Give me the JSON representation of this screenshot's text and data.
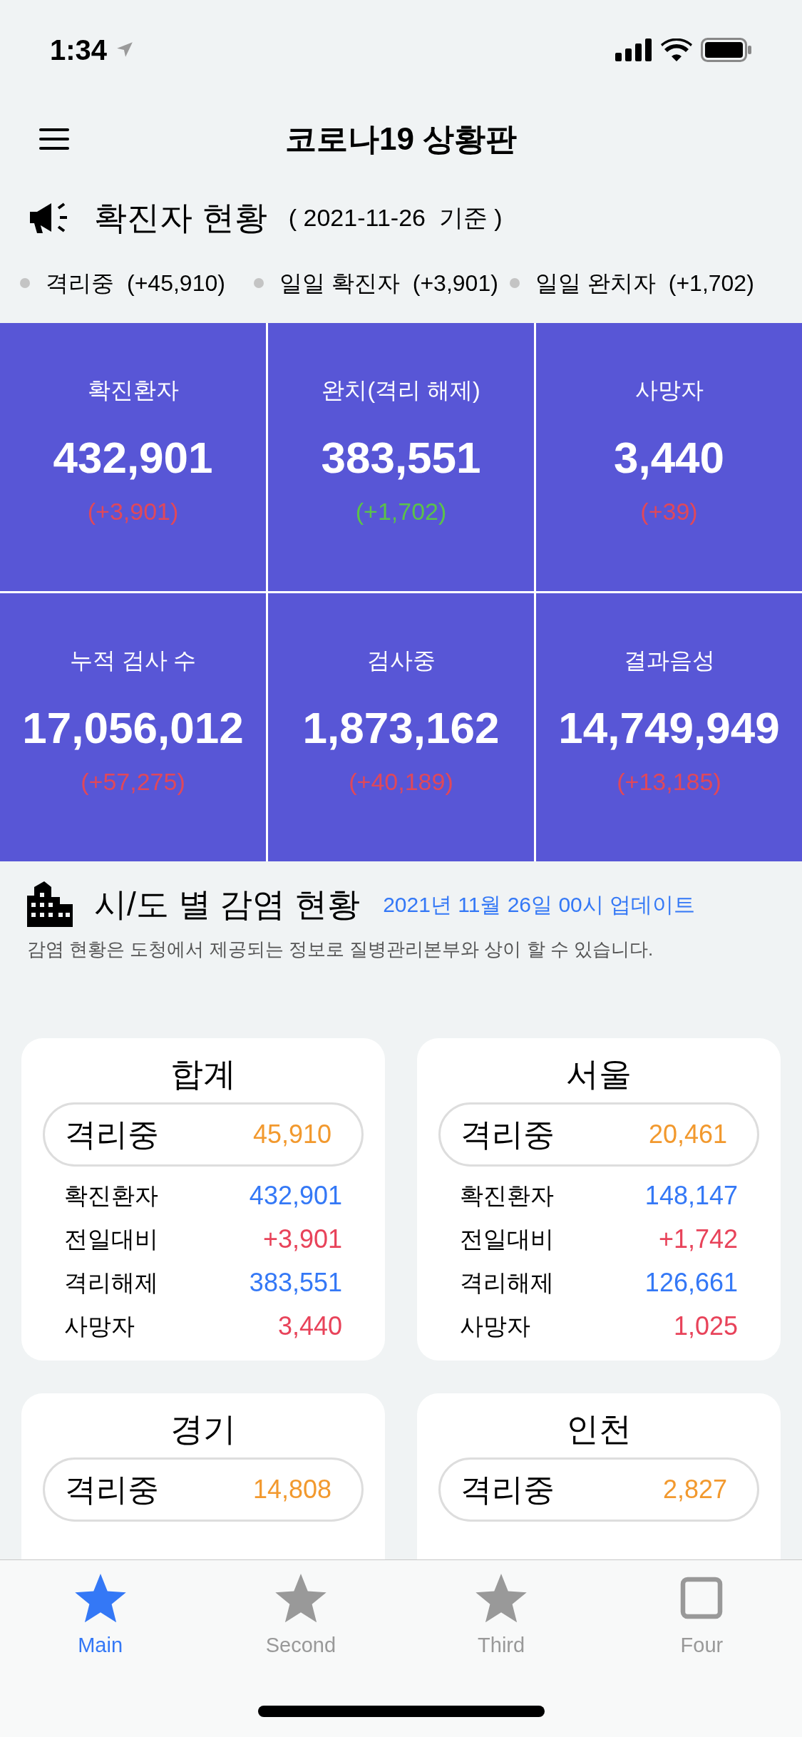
{
  "status_bar": {
    "time": "1:34"
  },
  "header": {
    "title": "코로나19 상황판"
  },
  "summary": {
    "title": "확진자 현황",
    "date": "( 2021-11-26  기준 )",
    "items": [
      {
        "label": "격리중",
        "value": "(+45,910)"
      },
      {
        "label": "일일 확진자",
        "value": "(+3,901)"
      },
      {
        "label": "일일 완치자",
        "value": "(+1,702)"
      }
    ]
  },
  "tiles": [
    {
      "label": "확진환자",
      "value": "432,901",
      "change": "(+3,901)",
      "color": "#e0485a"
    },
    {
      "label": "완치(격리 해제)",
      "value": "383,551",
      "change": "(+1,702)",
      "color": "#5bc24a"
    },
    {
      "label": "사망자",
      "value": "3,440",
      "change": "(+39)",
      "color": "#e0485a"
    },
    {
      "label": "누적 검사 수",
      "value": "17,056,012",
      "change": "(+57,275)",
      "color": "#e0485a"
    },
    {
      "label": "검사중",
      "value": "1,873,162",
      "change": "(+40,189)",
      "color": "#e0485a"
    },
    {
      "label": "결과음성",
      "value": "14,749,949",
      "change": "(+13,185)",
      "color": "#e0485a"
    }
  ],
  "regions": {
    "title": "시/도 별 감염 현황",
    "updated": "2021년 11월 26일 00시 업데이트",
    "note": "감염 현황은 도청에서 제공되는 정보로 질병관리본부와 상이 할 수 있습니다.",
    "cards": [
      {
        "name": "합계",
        "isolating_label": "격리중",
        "isolating_value": "45,910",
        "rows": [
          {
            "label": "확진환자",
            "value": "432,901",
            "color": "#3478f6"
          },
          {
            "label": "전일대비",
            "value": "+3,901",
            "color": "#e8435a"
          },
          {
            "label": "격리해제",
            "value": "383,551",
            "color": "#3478f6"
          },
          {
            "label": "사망자",
            "value": "3,440",
            "color": "#e8435a"
          }
        ]
      },
      {
        "name": "서울",
        "isolating_label": "격리중",
        "isolating_value": "20,461",
        "rows": [
          {
            "label": "확진환자",
            "value": "148,147",
            "color": "#3478f6"
          },
          {
            "label": "전일대비",
            "value": "+1,742",
            "color": "#e8435a"
          },
          {
            "label": "격리해제",
            "value": "126,661",
            "color": "#3478f6"
          },
          {
            "label": "사망자",
            "value": "1,025",
            "color": "#e8435a"
          }
        ]
      },
      {
        "name": "경기",
        "isolating_label": "격리중",
        "isolating_value": "14,808"
      },
      {
        "name": "인천",
        "isolating_label": "격리중",
        "isolating_value": "2,827"
      }
    ]
  },
  "tabs": [
    {
      "label": "Main",
      "kind": "star",
      "selected": true
    },
    {
      "label": "Second",
      "kind": "star",
      "selected": false
    },
    {
      "label": "Third",
      "kind": "star",
      "selected": false
    },
    {
      "label": "Four",
      "kind": "square",
      "selected": false
    }
  ]
}
